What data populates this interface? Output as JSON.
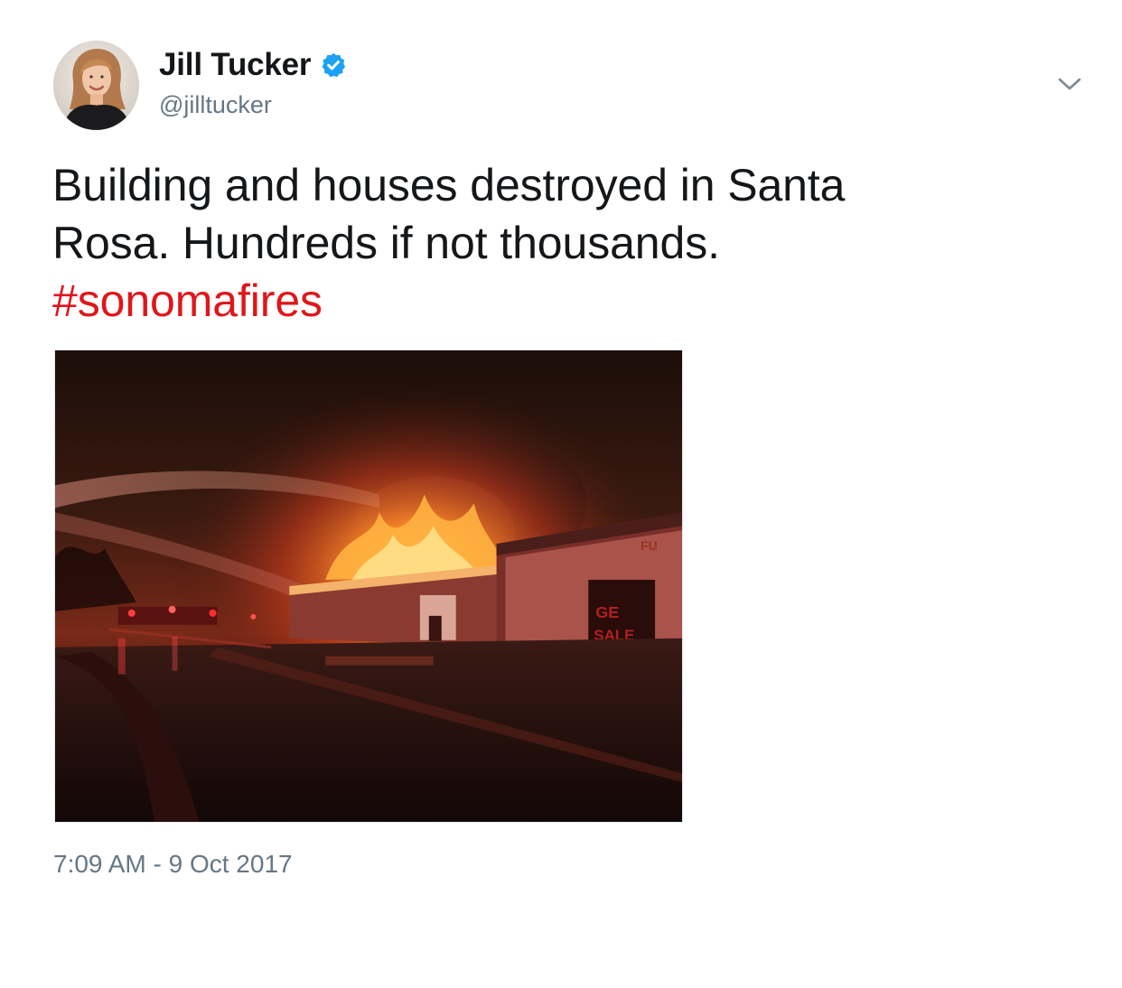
{
  "author": {
    "display_name": "Jill Tucker",
    "handle": "@jilltucker",
    "verified": true,
    "avatar_icon": "avatar-photo"
  },
  "tweet": {
    "text_line1": "Building and houses destroyed in Santa",
    "text_line2": "Rosa. Hundreds if not thousands.",
    "hashtag": "#sonomafires",
    "timestamp": "7:09 AM - 9 Oct 2017"
  },
  "media": {
    "sign_text_top": "FU",
    "sign_text_line1": "GE",
    "sign_text_line2": "SALE"
  },
  "icons": {
    "verified": "verified-badge-icon",
    "menu": "chevron-down-icon"
  },
  "colors": {
    "text": "#14171a",
    "secondary": "#657786",
    "hashtag": "#e0161b",
    "verified": "#1da1f2"
  }
}
